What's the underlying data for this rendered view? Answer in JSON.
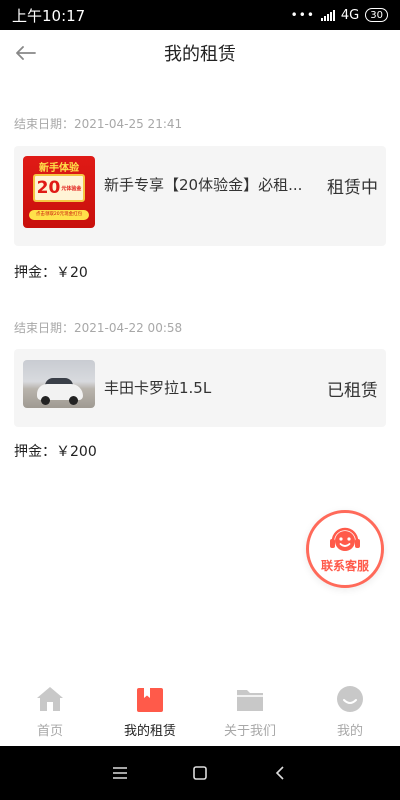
{
  "status_bar": {
    "time": "上午10:17",
    "network": "4G",
    "battery": "30"
  },
  "header": {
    "title": "我的租赁"
  },
  "orders": [
    {
      "end_date": "结束日期：2021-04-25 21:41",
      "name": "新手专享【20体验金】必租...",
      "status": "租赁中",
      "deposit": "押金：￥20",
      "thumb_promo_title": "新手体验",
      "thumb_promo_amount": "20",
      "thumb_promo_unit": "元体验金",
      "thumb_promo_bar": "点击领取20元现金红包"
    },
    {
      "end_date": "结束日期：2021-04-22 00:58",
      "name": "丰田卡罗拉1.5L",
      "status": "已租赁",
      "deposit": "押金：￥200"
    }
  ],
  "customer_service": {
    "label": "联系客服"
  },
  "tabs": [
    {
      "label": "首页",
      "icon": "home-icon",
      "active": false
    },
    {
      "label": "我的租赁",
      "icon": "bookmark-icon",
      "active": true
    },
    {
      "label": "关于我们",
      "icon": "folder-icon",
      "active": false
    },
    {
      "label": "我的",
      "icon": "profile-icon",
      "active": false
    }
  ],
  "colors": {
    "accent": "#ff5a4a",
    "inactive": "#a8a8a8"
  }
}
